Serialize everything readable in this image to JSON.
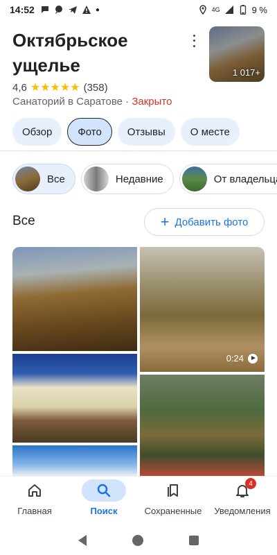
{
  "status_bar": {
    "time": "14:52",
    "network": "4G",
    "battery": "9 %"
  },
  "place": {
    "title": "Октябрьское ущелье",
    "rating": "4,6",
    "stars": "★★★★★",
    "reviews": "(358)",
    "category": "Санаторий в Саратове · ",
    "status": "Закрыто",
    "photo_count": "1 017+"
  },
  "tabs": [
    {
      "label": "Обзор"
    },
    {
      "label": "Фото"
    },
    {
      "label": "Отзывы"
    },
    {
      "label": "О месте"
    }
  ],
  "filters": [
    {
      "label": "Все"
    },
    {
      "label": "Недавние"
    },
    {
      "label": "От владельца"
    }
  ],
  "section": {
    "title": "Все",
    "add_button": "Добавить фото"
  },
  "photos": {
    "video_duration": "0:24"
  },
  "bottom_nav": [
    {
      "label": "Главная",
      "icon": "home-icon"
    },
    {
      "label": "Поиск",
      "icon": "search-icon"
    },
    {
      "label": "Сохраненные",
      "icon": "bookmark-icon"
    },
    {
      "label": "Уведомления",
      "icon": "bell-icon",
      "badge": "4"
    }
  ],
  "colors": {
    "accent": "#1a73e8",
    "closed": "#d93025",
    "star": "#fbbc04",
    "tab_bg": "#e8f0fe"
  }
}
